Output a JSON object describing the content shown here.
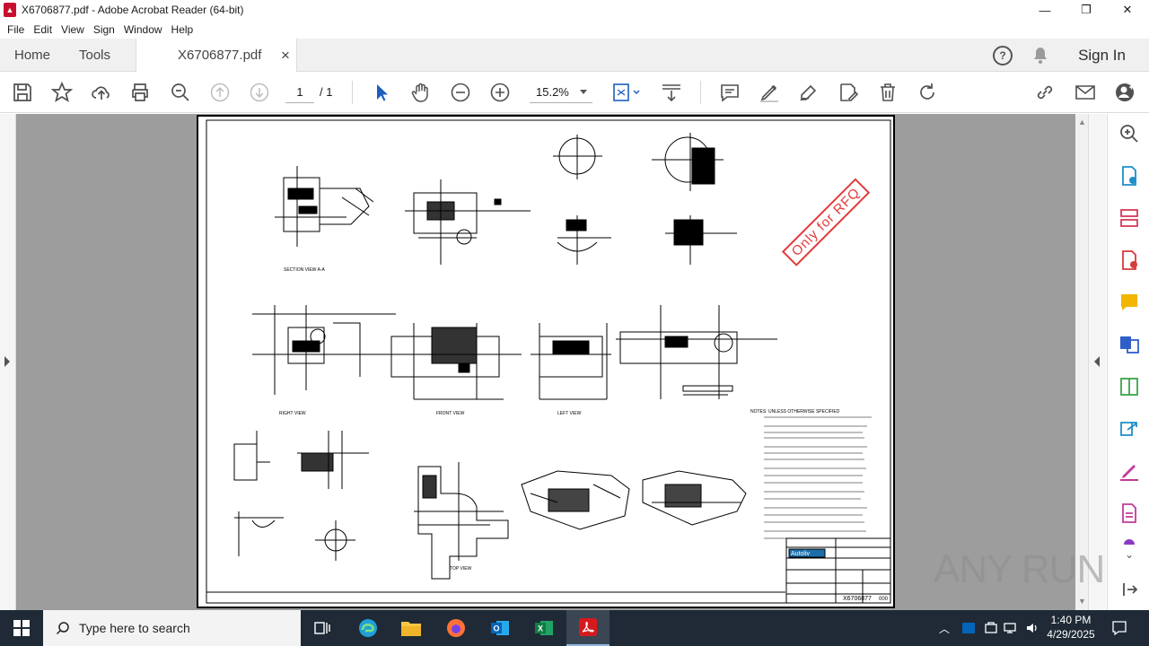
{
  "window": {
    "title": "X6706877.pdf - Adobe Acrobat Reader (64-bit)",
    "minimize": "—",
    "maximize": "❐",
    "close": "✕"
  },
  "menu": [
    "File",
    "Edit",
    "View",
    "Sign",
    "Window",
    "Help"
  ],
  "tabs": {
    "home": "Home",
    "tools": "Tools",
    "document": "X6706877.pdf",
    "close": "×"
  },
  "header": {
    "sign_in": "Sign In"
  },
  "toolbar": {
    "page_current": "1",
    "page_total": "/ 1",
    "zoom": "15.2%"
  },
  "document": {
    "stamp_text": "Only for RFQ",
    "title_block_brand": "Autoliv",
    "drawing_number": "X6706877",
    "revision": "000",
    "notes_heading": "NOTES: UNLESS OTHERWISE SPECIFIED",
    "view_labels": [
      "SECTION VIEW A-A",
      "RIGHT VIEW",
      "FRONT VIEW",
      "LEFT VIEW",
      "TOP VIEW"
    ]
  },
  "taskbar": {
    "search_placeholder": "Type here to search",
    "time": "1:40 PM",
    "date": "4/29/2025"
  },
  "watermark": "ANY RUN"
}
